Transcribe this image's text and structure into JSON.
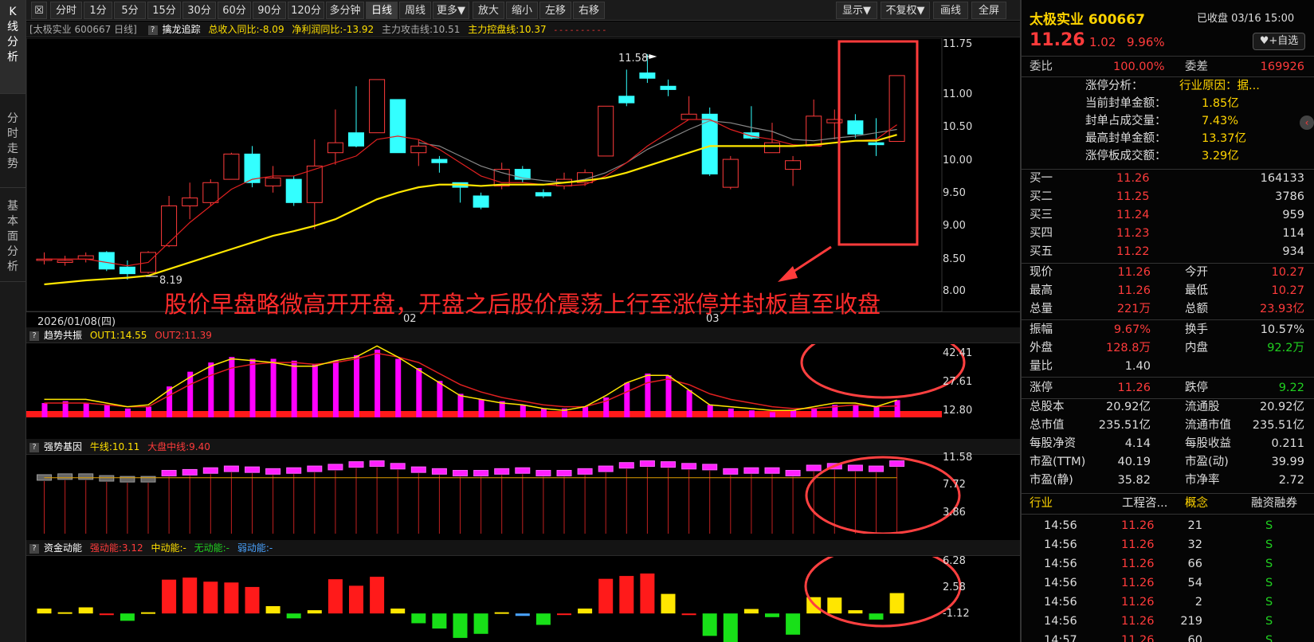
{
  "left_tabs": [
    "K线分析",
    "分时走势",
    "基本面分析"
  ],
  "toolbar": {
    "periods": [
      "分时",
      "1分",
      "5分",
      "15分",
      "30分",
      "60分",
      "90分",
      "120分",
      "多分钟",
      "日线",
      "周线",
      "更多▼"
    ],
    "actions": [
      "放大",
      "缩小",
      "左移",
      "右移"
    ],
    "right": [
      "显示▼",
      "不复权▼",
      "画线",
      "全屏"
    ]
  },
  "main_header": {
    "stock": "[太极实业 600667 日线]",
    "indicator": "擒龙追踪",
    "rev_yoy": "总收入同比:-8.09",
    "profit_yoy": "净利润同比:-13.92",
    "attack": "主力攻击线:10.51",
    "control": "主力控盘线:10.37",
    "dashes": "-  -  -  -  -  -  -  -  -  -"
  },
  "price_axis": [
    "11.75",
    "11.00",
    "10.50",
    "10.00",
    "9.50",
    "9.00",
    "8.50",
    "8.00"
  ],
  "date_label": "2026/01/08(四)",
  "month_labels": [
    "02",
    "03"
  ],
  "high_label": "11.58",
  "low_label": "8.19",
  "annotation": "股价早盘略微高开开盘，开盘之后股价震荡上行至涨停并封板直至收盘",
  "panel2": {
    "name": "趋势共振",
    "out1": "OUT1:14.55",
    "out2": "OUT2:11.39",
    "axis": [
      "42.41",
      "27.61",
      "12.80"
    ]
  },
  "panel3": {
    "name": "强势基因",
    "bull": "牛线:10.11",
    "market": "大盘中线:9.40",
    "axis": [
      "11.58",
      "7.72",
      "3.86"
    ]
  },
  "panel4": {
    "name": "资金动能",
    "strong": "强动能:3.12",
    "mid": "中动能:-",
    "none": "无动能:-",
    "weak": "弱动能:-",
    "axis": [
      "6.28",
      "2.58",
      "-1.12"
    ]
  },
  "quote": {
    "name": "太极实业",
    "code": "600667",
    "status": "已收盘 03/16 15:00",
    "price": "11.26",
    "change": "1.02",
    "pct": "9.96%",
    "add_button": "+自选",
    "weibi_label": "委比",
    "weibi": "100.00%",
    "weicha_label": "委差",
    "weicha": "169926",
    "limit_info": [
      [
        "涨停分析：",
        "行业原因：据..."
      ],
      [
        "当前封单金额：",
        "1.85亿"
      ],
      [
        "封单占成交量：",
        "7.43%"
      ],
      [
        "最高封单金额：",
        "13.37亿"
      ],
      [
        "涨停板成交额：",
        "3.29亿"
      ]
    ],
    "bids": [
      [
        "买一",
        "11.26",
        "164133"
      ],
      [
        "买二",
        "11.25",
        "3786"
      ],
      [
        "买三",
        "11.24",
        "959"
      ],
      [
        "买四",
        "11.23",
        "114"
      ],
      [
        "买五",
        "11.22",
        "934"
      ]
    ],
    "stats1": [
      [
        "现价",
        "11.26",
        "今开",
        "10.27"
      ],
      [
        "最高",
        "11.26",
        "最低",
        "10.27"
      ],
      [
        "总量",
        "221万",
        "总额",
        "23.93亿"
      ]
    ],
    "stats2": [
      [
        "振幅",
        "9.67%",
        "换手",
        "10.57%"
      ],
      [
        "外盘",
        "128.8万",
        "内盘",
        "92.2万"
      ],
      [
        "量比",
        "1.40",
        "",
        ""
      ]
    ],
    "stats3": [
      [
        "涨停",
        "11.26",
        "跌停",
        "9.22"
      ]
    ],
    "fundamentals": [
      [
        "总股本",
        "20.92亿",
        "流通股",
        "20.92亿"
      ],
      [
        "总市值",
        "235.51亿",
        "流通市值",
        "235.51亿"
      ],
      [
        "每股净资",
        "4.14",
        "每股收益",
        "0.211"
      ],
      [
        "市盈(TTM)",
        "40.19",
        "市盈(动)",
        "39.99"
      ],
      [
        "市盈(静)",
        "35.82",
        "市净率",
        "2.72"
      ]
    ],
    "tags": [
      "行业",
      "工程咨...",
      "概念",
      "融资融券"
    ],
    "ticks": [
      [
        "14:56",
        "11.26",
        "21",
        "S"
      ],
      [
        "14:56",
        "11.26",
        "32",
        "S"
      ],
      [
        "14:56",
        "11.26",
        "66",
        "S"
      ],
      [
        "14:56",
        "11.26",
        "54",
        "S"
      ],
      [
        "14:56",
        "11.26",
        "2",
        "S"
      ],
      [
        "14:56",
        "11.26",
        "219",
        "S"
      ],
      [
        "14:57",
        "11.26",
        "60",
        "S"
      ]
    ]
  },
  "chart_data": {
    "type": "candlestick",
    "ylim": [
      8.0,
      11.75
    ],
    "candles": [
      {
        "o": 8.48,
        "c": 8.5,
        "h": 8.6,
        "l": 8.42
      },
      {
        "o": 8.45,
        "c": 8.48,
        "h": 8.55,
        "l": 8.4
      },
      {
        "o": 8.5,
        "c": 8.55,
        "h": 8.6,
        "l": 8.45
      },
      {
        "o": 8.6,
        "c": 8.35,
        "h": 8.62,
        "l": 8.32
      },
      {
        "o": 8.38,
        "c": 8.28,
        "h": 8.48,
        "l": 8.19
      },
      {
        "o": 8.3,
        "c": 8.6,
        "h": 8.62,
        "l": 8.28
      },
      {
        "o": 8.7,
        "c": 9.3,
        "h": 9.45,
        "l": 8.68
      },
      {
        "o": 9.3,
        "c": 9.42,
        "h": 9.65,
        "l": 9.1
      },
      {
        "o": 9.35,
        "c": 9.65,
        "h": 9.7,
        "l": 9.3
      },
      {
        "o": 9.7,
        "c": 10.08,
        "h": 10.1,
        "l": 9.7
      },
      {
        "o": 10.08,
        "c": 9.65,
        "h": 10.2,
        "l": 9.58
      },
      {
        "o": 9.6,
        "c": 9.72,
        "h": 9.9,
        "l": 9.5
      },
      {
        "o": 9.7,
        "c": 9.35,
        "h": 9.75,
        "l": 9.3
      },
      {
        "o": 9.35,
        "c": 9.9,
        "h": 10.3,
        "l": 8.95
      },
      {
        "o": 10.1,
        "c": 10.25,
        "h": 10.75,
        "l": 9.92
      },
      {
        "o": 10.4,
        "c": 10.2,
        "h": 11.1,
        "l": 10.18
      },
      {
        "o": 10.4,
        "c": 11.2,
        "h": 11.2,
        "l": 10.4
      },
      {
        "o": 10.9,
        "c": 10.1,
        "h": 10.9,
        "l": 10.1
      },
      {
        "o": 10.1,
        "c": 10.2,
        "h": 10.3,
        "l": 9.9
      },
      {
        "o": 10.0,
        "c": 9.95,
        "h": 10.05,
        "l": 9.8
      },
      {
        "o": 9.65,
        "c": 9.58,
        "h": 9.65,
        "l": 9.35
      },
      {
        "o": 9.45,
        "c": 9.28,
        "h": 9.5,
        "l": 9.25
      },
      {
        "o": 9.6,
        "c": 9.85,
        "h": 9.95,
        "l": 9.55
      },
      {
        "o": 9.85,
        "c": 9.7,
        "h": 9.9,
        "l": 9.65
      },
      {
        "o": 9.5,
        "c": 9.45,
        "h": 9.55,
        "l": 9.42
      },
      {
        "o": 9.6,
        "c": 9.7,
        "h": 9.8,
        "l": 9.55
      },
      {
        "o": 9.65,
        "c": 9.8,
        "h": 9.85,
        "l": 9.6
      },
      {
        "o": 10.05,
        "c": 10.8,
        "h": 10.8,
        "l": 10.05
      },
      {
        "o": 10.95,
        "c": 10.85,
        "h": 11.35,
        "l": 10.8
      },
      {
        "o": 11.3,
        "c": 11.22,
        "h": 11.58,
        "l": 11.15
      },
      {
        "o": 11.1,
        "c": 11.05,
        "h": 11.2,
        "l": 10.95
      },
      {
        "o": 10.6,
        "c": 10.68,
        "h": 10.95,
        "l": 10.6
      },
      {
        "o": 10.68,
        "c": 9.78,
        "h": 10.78,
        "l": 9.75
      },
      {
        "o": 9.58,
        "c": 10.0,
        "h": 10.05,
        "l": 9.55
      },
      {
        "o": 10.4,
        "c": 10.32,
        "h": 10.8,
        "l": 10.3
      },
      {
        "o": 10.1,
        "c": 10.25,
        "h": 10.55,
        "l": 10.1
      },
      {
        "o": 9.85,
        "c": 9.98,
        "h": 10.05,
        "l": 9.6
      },
      {
        "o": 10.2,
        "c": 10.65,
        "h": 10.9,
        "l": 10.2
      },
      {
        "o": 10.55,
        "c": 10.6,
        "h": 10.75,
        "l": 10.3
      },
      {
        "o": 10.58,
        "c": 10.38,
        "h": 10.68,
        "l": 10.32
      },
      {
        "o": 10.25,
        "c": 10.22,
        "h": 10.62,
        "l": 10.05
      },
      {
        "o": 10.27,
        "c": 11.26,
        "h": 11.26,
        "l": 10.27
      }
    ],
    "ma_short": [
      8.5,
      8.5,
      8.5,
      8.45,
      8.4,
      8.45,
      8.75,
      9.05,
      9.3,
      9.55,
      9.7,
      9.75,
      9.75,
      9.85,
      9.95,
      10.05,
      10.3,
      10.35,
      10.3,
      10.15,
      9.95,
      9.75,
      9.65,
      9.65,
      9.62,
      9.6,
      9.62,
      9.75,
      9.95,
      10.2,
      10.4,
      10.6,
      10.6,
      10.45,
      10.35,
      10.3,
      10.22,
      10.2,
      10.25,
      10.28,
      10.3,
      10.52
    ],
    "ma_mid": [
      null,
      null,
      null,
      null,
      null,
      null,
      null,
      null,
      null,
      null,
      null,
      null,
      null,
      null,
      null,
      null,
      null,
      null,
      10.25,
      10.2,
      10.05,
      9.9,
      9.8,
      9.72,
      9.68,
      9.65,
      9.7,
      9.8,
      9.95,
      10.15,
      10.3,
      10.45,
      10.58,
      10.55,
      10.48,
      10.42,
      10.3,
      10.28,
      10.32,
      10.35,
      10.4,
      10.45
    ],
    "ma_long": [
      8.12,
      8.15,
      8.18,
      8.2,
      8.22,
      8.25,
      8.35,
      8.45,
      8.55,
      8.65,
      8.75,
      8.85,
      8.92,
      9.0,
      9.1,
      9.25,
      9.4,
      9.5,
      9.58,
      9.62,
      9.62,
      9.6,
      9.62,
      9.62,
      9.62,
      9.65,
      9.68,
      9.72,
      9.8,
      9.9,
      10.0,
      10.1,
      10.2,
      10.2,
      10.2,
      10.2,
      10.2,
      10.22,
      10.25,
      10.28,
      10.28,
      10.37
    ],
    "trend_bars": [
      13,
      14,
      13,
      12,
      10,
      11,
      22,
      30,
      35,
      38,
      37,
      37,
      36,
      34,
      36,
      39,
      42,
      37,
      32,
      25,
      18,
      15,
      14,
      12,
      10,
      10,
      11,
      16,
      24,
      29,
      28,
      20,
      12,
      10,
      9,
      8,
      9,
      10,
      12,
      12,
      11,
      14.55
    ],
    "trend_out1": [
      15,
      15,
      15,
      13,
      11,
      12,
      20,
      27,
      33,
      37,
      36,
      35,
      33,
      33,
      36,
      38,
      44,
      38,
      31,
      24,
      17,
      15,
      13,
      12,
      10,
      9,
      11,
      17,
      24,
      28,
      28,
      20,
      12,
      11,
      10,
      9,
      9,
      11,
      13,
      13,
      11,
      14.55
    ],
    "trend_out2": [
      13,
      13,
      13,
      12,
      11,
      11,
      17,
      23,
      28,
      32,
      34,
      35,
      35,
      34,
      35,
      37,
      40,
      38,
      35,
      29,
      23,
      19,
      16,
      14,
      12,
      11,
      11,
      14,
      19,
      24,
      26,
      23,
      18,
      15,
      13,
      11,
      10,
      10,
      11,
      12,
      11,
      11.39
    ],
    "gene_bars": [
      9.8,
      9.9,
      9.9,
      9.7,
      9.6,
      9.6,
      10.3,
      10.4,
      10.6,
      10.8,
      10.7,
      10.5,
      10.6,
      10.8,
      11.0,
      11.3,
      11.4,
      11.1,
      10.7,
      10.5,
      10.3,
      10.3,
      10.5,
      10.6,
      10.3,
      10.3,
      10.5,
      10.8,
      11.2,
      11.4,
      11.3,
      11.1,
      11.0,
      10.5,
      10.6,
      10.6,
      10.3,
      10.9,
      11.1,
      10.9,
      10.8,
      11.4
    ],
    "momentum": [
      1.2,
      0.3,
      1.5,
      -0.4,
      -1.8,
      0.3,
      8.3,
      8.8,
      7.8,
      7.6,
      6.5,
      1.8,
      -1.2,
      0.8,
      8.4,
      6.8,
      9.0,
      1.2,
      -2.4,
      -3.7,
      -6.0,
      -5.0,
      0.3,
      -0.6,
      -2.8,
      -0.2,
      1.2,
      8.5,
      9.2,
      9.8,
      4.8,
      -0.4,
      -5.5,
      -7.0,
      1.1,
      -0.9,
      -5.2,
      4.0,
      3.9,
      0.8,
      -1.5,
      5.0
    ]
  }
}
